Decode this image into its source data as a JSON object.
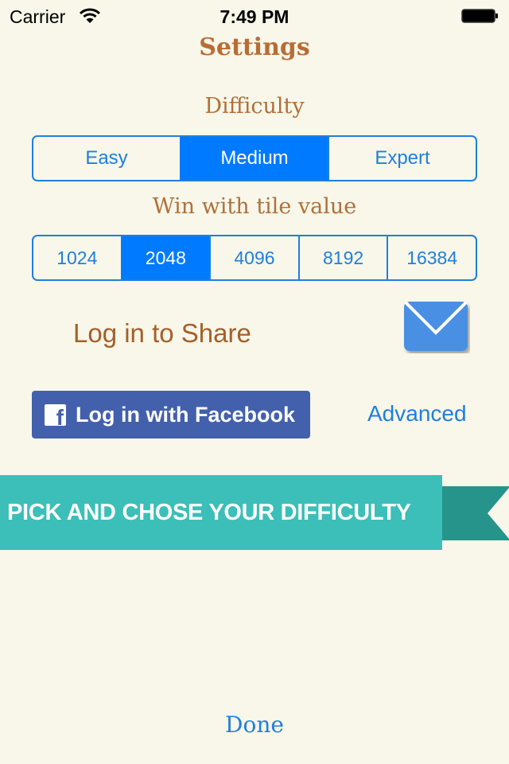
{
  "status_bar": {
    "carrier": "Carrier",
    "time": "7:49 PM",
    "wifi_icon": "wifi-icon",
    "battery_icon": "battery-full-icon"
  },
  "header": {
    "title": "Settings"
  },
  "difficulty": {
    "label": "Difficulty",
    "options": [
      "Easy",
      "Medium",
      "Expert"
    ],
    "selected": "Medium"
  },
  "tile_value": {
    "label": "Win with tile value",
    "options": [
      "1024",
      "2048",
      "4096",
      "8192",
      "16384"
    ],
    "selected": "2048"
  },
  "share": {
    "label": "Log in to Share",
    "mail_icon": "envelope-icon"
  },
  "facebook": {
    "icon": "facebook-icon",
    "icon_glyph": "f",
    "label": "Log in with Facebook"
  },
  "advanced": {
    "label": "Advanced"
  },
  "banner": {
    "text": "PICK AND CHOSE YOUR DIFFICULTY"
  },
  "footer": {
    "done_label": "Done"
  },
  "colors": {
    "background": "#f8f7e9",
    "accent_blue": "#007aff",
    "title_brown": "#b86d36",
    "facebook_blue": "#4360ad",
    "ribbon_teal": "#3bbfb8",
    "ribbon_tail_teal": "#26948a",
    "mail_blue": "#4a8fe3"
  }
}
